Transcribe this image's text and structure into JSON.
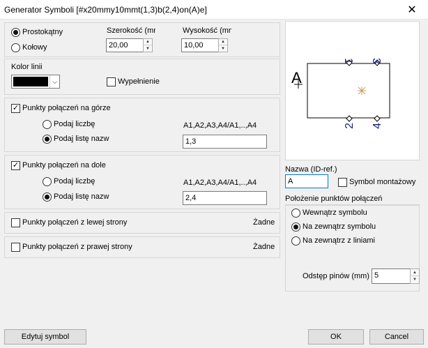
{
  "window": {
    "title": "Generator Symboli [#x20mmy10mmt(1,3)b(2,4)on(A)e]",
    "close": "✕"
  },
  "shape": {
    "rect_label": "Prostokątny",
    "circle_label": "Kołowy",
    "width_label": "Szerokość (mm",
    "height_label": "Wysokość (mm",
    "width_value": "20,00",
    "height_value": "10,00"
  },
  "line": {
    "color_label": "Kolor linii",
    "fill_label": "Wypełnienie",
    "color": "#000000"
  },
  "top": {
    "title": "Punkty połączeń na górze",
    "count_label": "Podaj liczbę",
    "list_label": "Podaj listę nazw",
    "hint": "A1,A2,A3,A4/A1,..,A4",
    "list_value": "1,3"
  },
  "bottom": {
    "title": "Punkty połączeń na dole",
    "count_label": "Podaj liczbę",
    "list_label": "Podaj listę nazw",
    "hint": "A1,A2,A3,A4/A1,..,A4",
    "list_value": "2,4"
  },
  "left": {
    "title": "Punkty połączeń z lewej strony",
    "status": "Żadne"
  },
  "right": {
    "title": "Punkty połączeń z prawej strony",
    "status": "Żadne"
  },
  "preview": {
    "name_text": "A",
    "pins_top": [
      "1",
      "3"
    ],
    "pins_bottom": [
      "2",
      "4"
    ]
  },
  "name": {
    "label": "Nazwa (ID-ref.)",
    "value": "A",
    "mounting_label": "Symbol montażowy"
  },
  "placement": {
    "label": "Położenie punktów połączeń",
    "inside": "Wewnątrz symbolu",
    "outside": "Na zewnątrz symbolu",
    "outside_lines": "Na zewnątrz z liniami",
    "pitch_label": "Odstęp pinów (mm)",
    "pitch_value": "5"
  },
  "buttons": {
    "edit": "Edytuj symbol",
    "ok": "OK",
    "cancel": "Cancel"
  }
}
